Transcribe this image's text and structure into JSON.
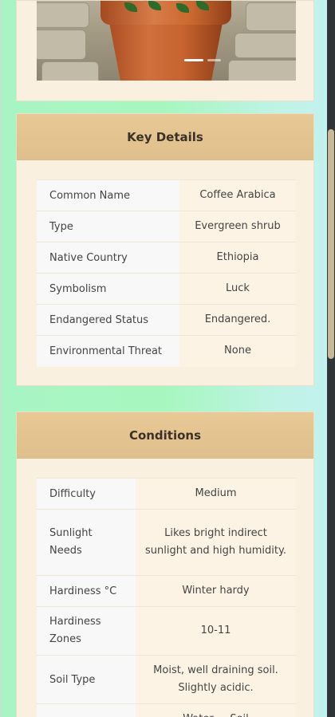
{
  "key_details": {
    "title": "Key Details",
    "rows": [
      {
        "label": "Common Name",
        "value": "Coffee Arabica"
      },
      {
        "label": "Type",
        "value": "Evergreen shrub"
      },
      {
        "label": "Native Country",
        "value": "Ethiopia"
      },
      {
        "label": "Symbolism",
        "value": "Luck"
      },
      {
        "label": "Endangered Status",
        "value": "Endangered."
      },
      {
        "label": "Environmental Threat",
        "value": "None"
      }
    ]
  },
  "conditions": {
    "title": "Conditions",
    "rows": [
      {
        "label": "Difficulty",
        "value": "Medium"
      },
      {
        "label": "Sunlight Needs",
        "value": "Likes bright indirect sunlight and high humidity."
      },
      {
        "label": "Hardiness °C",
        "value": "Winter hardy"
      },
      {
        "label": "Hardiness Zones",
        "value": "10-11"
      },
      {
        "label": "Soil Type",
        "value": "Moist, well draining soil. Slightly acidic."
      },
      {
        "label": "",
        "value": "Water ... Soil"
      }
    ]
  },
  "carousel": {
    "slides": 2,
    "active": 1
  }
}
